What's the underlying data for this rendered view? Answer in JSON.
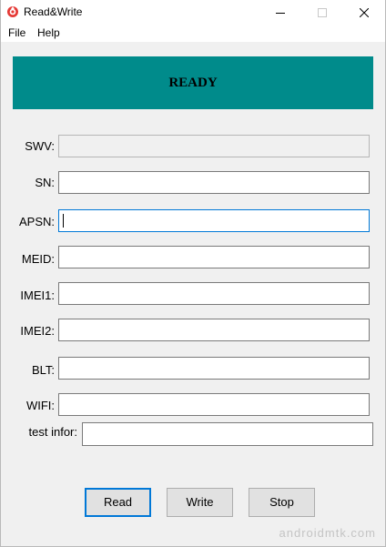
{
  "window": {
    "title": "Read&Write",
    "minimize_glyph": "minimize-icon",
    "maximize_glyph": "maximize-icon",
    "close_glyph": "close-icon"
  },
  "menu": {
    "file": "File",
    "help": "Help"
  },
  "status": {
    "text": "READY",
    "background": "#008b8b"
  },
  "fields": [
    {
      "label": "SWV:",
      "value": "",
      "enabled": false
    },
    {
      "label": "SN:",
      "value": "",
      "enabled": true
    },
    {
      "label": "APSN:",
      "value": "",
      "enabled": true,
      "focused": true
    },
    {
      "label": "MEID:",
      "value": "",
      "enabled": true
    },
    {
      "label": "IMEI1:",
      "value": "",
      "enabled": true
    },
    {
      "label": "IMEI2:",
      "value": "",
      "enabled": true
    },
    {
      "label": "BLT:",
      "value": "",
      "enabled": true
    },
    {
      "label": "WIFI:",
      "value": "",
      "enabled": true
    },
    {
      "label": "test infor:",
      "value": "",
      "enabled": true
    }
  ],
  "buttons": {
    "read": "Read",
    "write": "Write",
    "stop": "Stop"
  },
  "watermark": "androidmtk.com",
  "colors": {
    "accent": "#0078d7"
  }
}
